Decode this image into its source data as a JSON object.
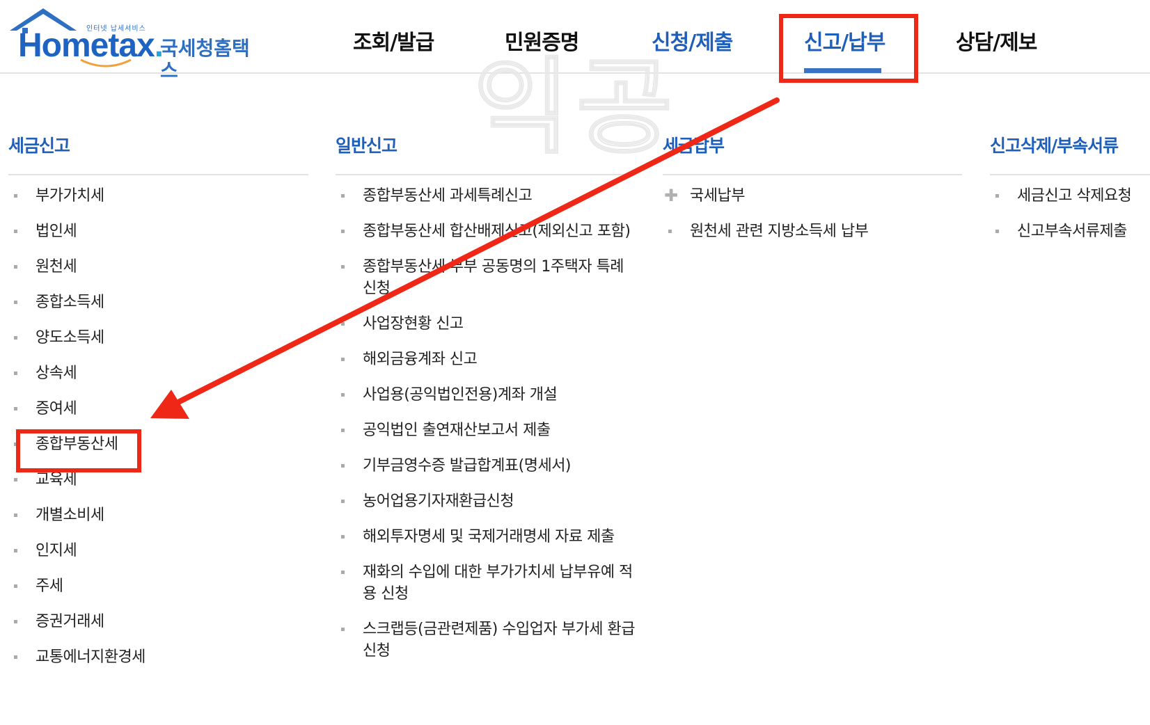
{
  "logo": {
    "tagline": "인터넷 납세서비스",
    "word_main": "Hometax",
    "word_dot": ".",
    "korean": "국세청홈택스"
  },
  "nav": {
    "items": [
      {
        "label": "조회/발급"
      },
      {
        "label": "민원증명"
      },
      {
        "label": "신청/제출"
      },
      {
        "label": "신고/납부",
        "active": true
      },
      {
        "label": "상담/제보"
      }
    ]
  },
  "watermark": "익공",
  "columns": [
    {
      "title": "세금신고",
      "items": [
        "부가가치세",
        "법인세",
        "원천세",
        "종합소득세",
        "양도소득세",
        "상속세",
        "증여세",
        "종합부동산세",
        "교육세",
        "개별소비세",
        "인지세",
        "주세",
        "증권거래세",
        "교통에너지환경세"
      ]
    },
    {
      "title": "일반신고",
      "items": [
        "종합부동산세 과세특례신고",
        "종합부동산세 합산배제신고(제외신고 포함)",
        "종합부동산세 부부 공동명의 1주택자 특례 신청",
        "사업장현황 신고",
        "해외금융계좌 신고",
        "사업용(공익법인전용)계좌 개설",
        "공익법인 출연재산보고서 제출",
        "기부금영수증 발급합계표(명세서)",
        "농어업용기자재환급신청",
        "해외투자명세 및 국제거래명세 자료 제출",
        "재화의 수입에 대한 부가가치세 납부유예 적용 신청",
        "스크랩등(금관련제품) 수입업자 부가세 환급신청"
      ]
    },
    {
      "title": "세금납부",
      "items": [
        "국세납부",
        "원천세 관련 지방소득세 납부"
      ]
    },
    {
      "title": "신고삭제/부속서류",
      "items": [
        "세금신고 삭제요청",
        "신고부속서류제출"
      ]
    }
  ],
  "annotation": {
    "color": "#ef2716"
  },
  "colors": {
    "brand_blue": "#1f5fba",
    "active_underline": "#3a72c4"
  }
}
